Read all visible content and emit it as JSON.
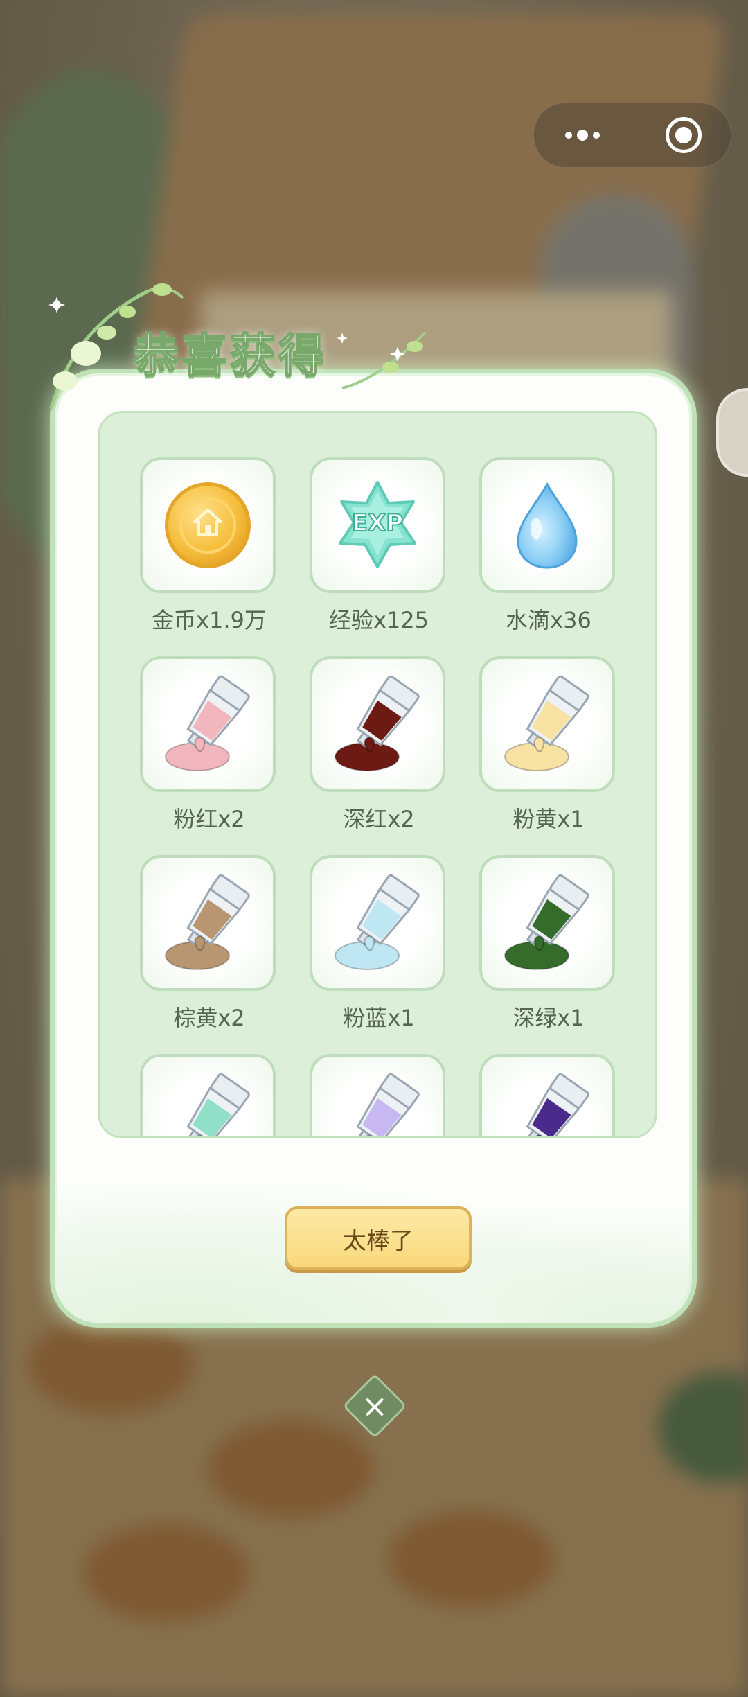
{
  "title": "恭喜获得",
  "rewards": [
    {
      "icon": "coin-icon",
      "label": "金币x1.9万"
    },
    {
      "icon": "exp-icon",
      "label": "经验x125",
      "icon_text": "EXP"
    },
    {
      "icon": "water-drop-icon",
      "label": "水滴x36"
    },
    {
      "icon": "paint-tube-icon",
      "label": "粉红x2",
      "color": "#f2b6bf"
    },
    {
      "icon": "paint-tube-icon",
      "label": "深红x2",
      "color": "#6e1a14"
    },
    {
      "icon": "paint-tube-icon",
      "label": "粉黄x1",
      "color": "#f8e2a3"
    },
    {
      "icon": "paint-tube-icon",
      "label": "棕黄x2",
      "color": "#b89672"
    },
    {
      "icon": "paint-tube-icon",
      "label": "粉蓝x1",
      "color": "#bfe6f3"
    },
    {
      "icon": "paint-tube-icon",
      "label": "深绿x1",
      "color": "#356b2b"
    },
    {
      "icon": "paint-tube-icon",
      "label": "",
      "color": "#8fe0c7"
    },
    {
      "icon": "paint-tube-icon",
      "label": "",
      "color": "#c8b8f2"
    },
    {
      "icon": "paint-tube-icon",
      "label": "",
      "color": "#4a2b8c"
    }
  ],
  "confirm_button": "太棒了",
  "colors": {
    "accent_green": "#bfe2b8",
    "panel": "#dcefd8",
    "button": "#f8d87a"
  }
}
